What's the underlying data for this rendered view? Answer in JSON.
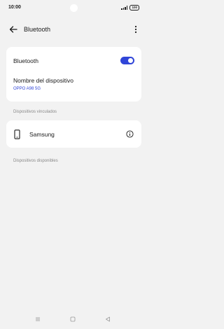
{
  "status_bar": {
    "time": "10:00",
    "battery": "100"
  },
  "app_bar": {
    "title": "Bluetooth"
  },
  "bluetooth": {
    "label": "Bluetooth",
    "enabled": true,
    "accent": "#3045d8"
  },
  "device": {
    "label": "Nombre del dispositivo",
    "value": "OPPO A98 5G"
  },
  "paired": {
    "heading": "Dispositivos vinculados",
    "devices": [
      {
        "name": "Samsung"
      }
    ]
  },
  "available": {
    "heading": "Dispositivos disponibles"
  },
  "icons": [
    "back-arrow-icon",
    "more-vert-icon",
    "phone-icon",
    "info-icon",
    "menu-icon",
    "home-icon",
    "back-icon"
  ]
}
